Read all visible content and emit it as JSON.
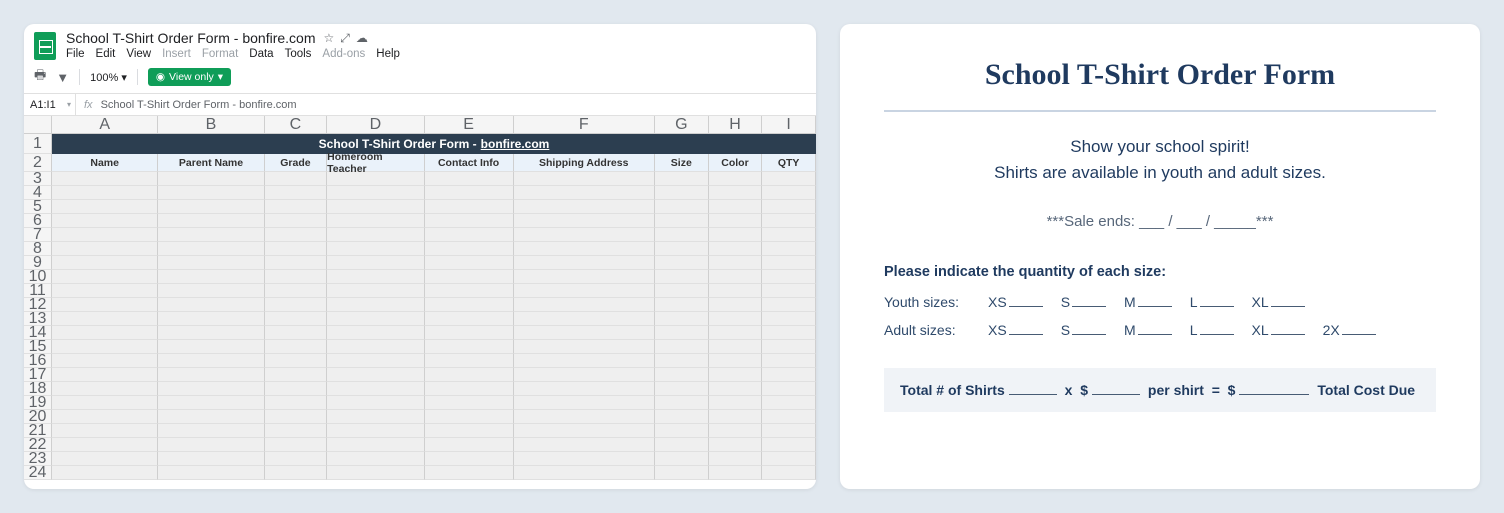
{
  "sheets": {
    "docTitle": "School T-Shirt Order Form - bonfire.com",
    "menus": [
      "File",
      "Edit",
      "View",
      "Insert",
      "Format",
      "Data",
      "Tools",
      "Add-ons",
      "Help"
    ],
    "disabledMenus": [
      "Insert",
      "Format",
      "Add-ons"
    ],
    "toolbar": {
      "zoom": "100%",
      "viewOnly": "View only"
    },
    "formulaBar": {
      "nameBox": "A1:I1",
      "fx": "fx",
      "content": "School T-Shirt Order Form - bonfire.com"
    },
    "columns": [
      "A",
      "B",
      "C",
      "D",
      "E",
      "F",
      "G",
      "H",
      "I"
    ],
    "titleRow": {
      "text": "School T-Shirt Order Form -",
      "link": "bonfire.com"
    },
    "headerRow": [
      "Name",
      "Parent Name",
      "Grade",
      "Homeroom Teacher",
      "Contact Info",
      "Shipping Address",
      "Size",
      "Color",
      "QTY"
    ],
    "rowNumbers": [
      "1",
      "2",
      "3",
      "4",
      "5",
      "6",
      "7",
      "8",
      "9",
      "10",
      "11",
      "12",
      "13",
      "14",
      "15",
      "16",
      "17",
      "18",
      "19",
      "20",
      "21",
      "22",
      "23",
      "24"
    ]
  },
  "form": {
    "title": "School T-Shirt Order Form",
    "spiritLine1": "Show your school spirit!",
    "spiritLine2": "Shirts are available in youth and adult sizes.",
    "saleEnds": "***Sale ends: ___ / ___ / _____***",
    "prompt": "Please indicate the quantity of each size:",
    "youthLabel": "Youth sizes:",
    "adultLabel": "Adult sizes:",
    "youthSizes": [
      "XS",
      "S",
      "M",
      "L",
      "XL"
    ],
    "adultSizes": [
      "XS",
      "S",
      "M",
      "L",
      "XL",
      "2X"
    ],
    "total": {
      "label": "Total # of Shirts",
      "mid": "per shirt",
      "equals": "=",
      "end": "Total Cost Due"
    }
  }
}
